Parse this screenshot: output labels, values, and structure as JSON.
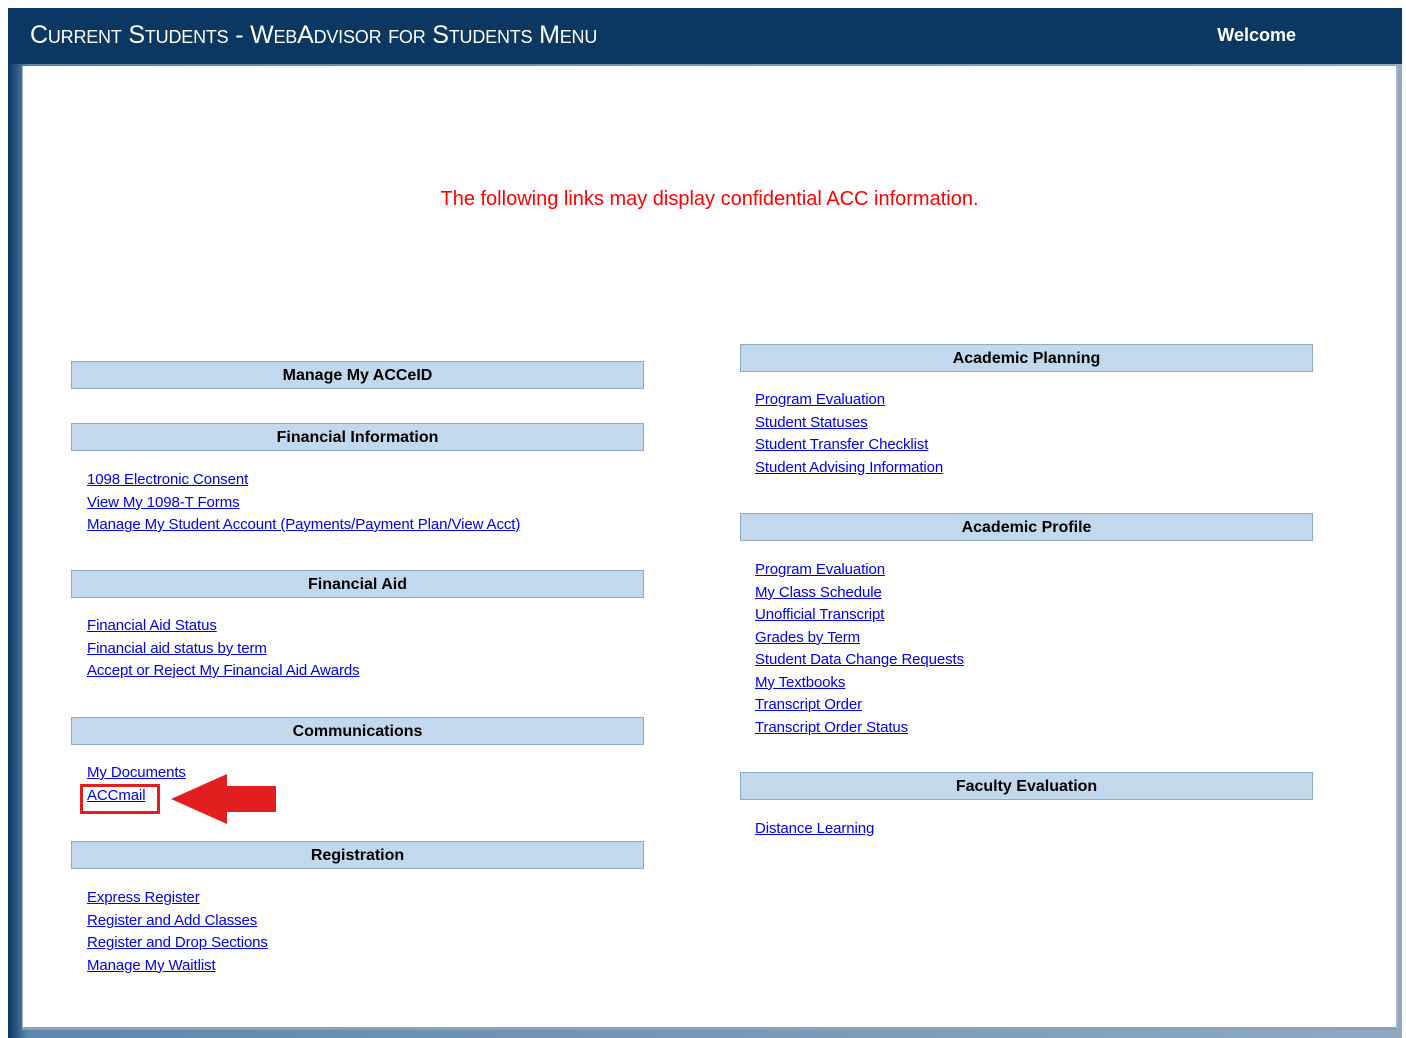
{
  "header": {
    "title": "Current Students - WebAdvisor for Students Menu",
    "welcome": "Welcome"
  },
  "notice": "The following links may display confidential ACC information.",
  "left_sections": [
    {
      "title": "Manage My ACCeID",
      "links": []
    },
    {
      "title": "Financial Information",
      "links": [
        "1098 Electronic Consent",
        "View My 1098-T Forms",
        "Manage My Student Account (Payments/Payment Plan/View Acct)"
      ]
    },
    {
      "title": "Financial Aid",
      "links": [
        "Financial Aid Status",
        "Financial aid status by term",
        "Accept or Reject My Financial Aid Awards"
      ]
    },
    {
      "title": "Communications",
      "links": [
        "My Documents",
        "ACCmail"
      ]
    },
    {
      "title": "Registration",
      "links": [
        "Express Register",
        "Register and Add Classes",
        "Register and Drop Sections",
        "Manage My Waitlist"
      ]
    }
  ],
  "right_sections": [
    {
      "title": "Academic Planning",
      "links": [
        "Program Evaluation",
        "Student Statuses",
        "Student Transfer Checklist",
        "Student Advising Information"
      ]
    },
    {
      "title": "Academic Profile",
      "links": [
        "Program Evaluation",
        "My Class Schedule",
        "Unofficial Transcript",
        "Grades by Term",
        "Student Data Change Requests",
        "My Textbooks",
        "Transcript Order",
        "Transcript Order Status"
      ]
    },
    {
      "title": "Faculty Evaluation",
      "links": [
        "Distance Learning"
      ]
    }
  ],
  "colors": {
    "header_bg": "#0b3863",
    "section_header_bg": "#c2d8ec",
    "link": "#0000ee",
    "notice": "#ff0000",
    "annotation": "#e21e1e"
  },
  "annotation": {
    "highlighted_link": "ACCmail",
    "icon": "left-arrow-icon"
  }
}
